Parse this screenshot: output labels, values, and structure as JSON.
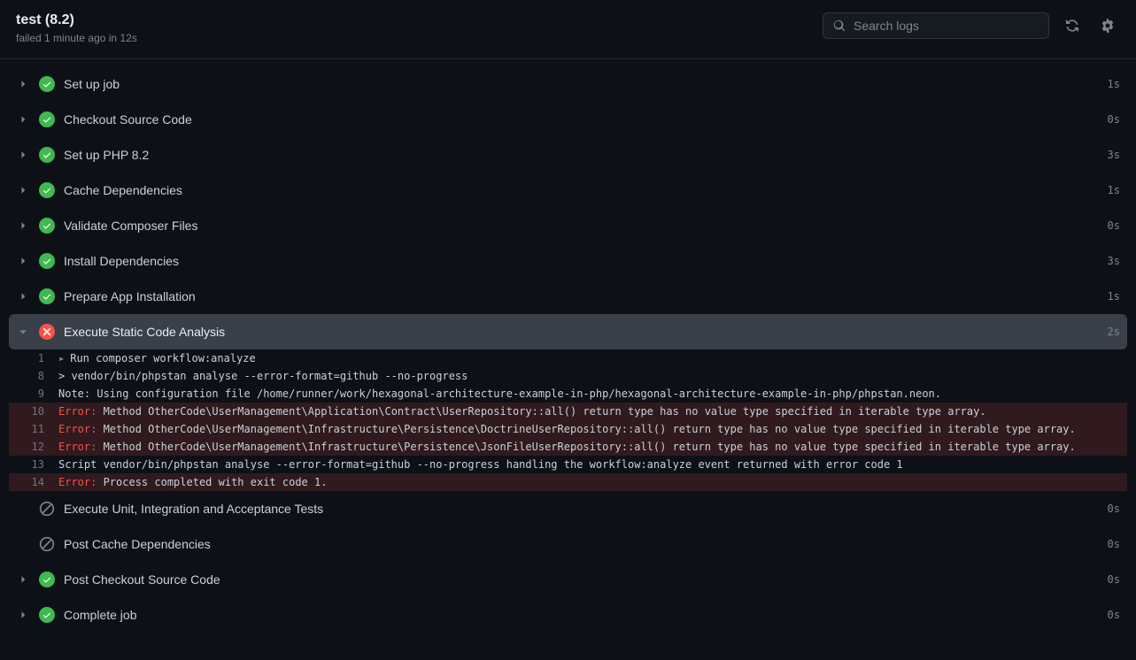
{
  "header": {
    "title": "test (8.2)",
    "status_word": "failed",
    "when": "1 minute ago",
    "duration_join": "in",
    "duration": "12s",
    "search_placeholder": "Search logs"
  },
  "steps": [
    {
      "name": "Set up job",
      "status": "success",
      "duration": "1s",
      "expandable": true,
      "expanded": false
    },
    {
      "name": "Checkout Source Code",
      "status": "success",
      "duration": "0s",
      "expandable": true,
      "expanded": false
    },
    {
      "name": "Set up PHP 8.2",
      "status": "success",
      "duration": "3s",
      "expandable": true,
      "expanded": false
    },
    {
      "name": "Cache Dependencies",
      "status": "success",
      "duration": "1s",
      "expandable": true,
      "expanded": false
    },
    {
      "name": "Validate Composer Files",
      "status": "success",
      "duration": "0s",
      "expandable": true,
      "expanded": false
    },
    {
      "name": "Install Dependencies",
      "status": "success",
      "duration": "3s",
      "expandable": true,
      "expanded": false
    },
    {
      "name": "Prepare App Installation",
      "status": "success",
      "duration": "1s",
      "expandable": true,
      "expanded": false
    },
    {
      "name": "Execute Static Code Analysis",
      "status": "fail",
      "duration": "2s",
      "expandable": true,
      "expanded": true
    },
    {
      "name": "Execute Unit, Integration and Acceptance Tests",
      "status": "skipped",
      "duration": "0s",
      "expandable": false,
      "expanded": false
    },
    {
      "name": "Post Cache Dependencies",
      "status": "skipped",
      "duration": "0s",
      "expandable": false,
      "expanded": false
    },
    {
      "name": "Post Checkout Source Code",
      "status": "success",
      "duration": "0s",
      "expandable": true,
      "expanded": false
    },
    {
      "name": "Complete job",
      "status": "success",
      "duration": "0s",
      "expandable": true,
      "expanded": false
    }
  ],
  "log": {
    "lines": [
      {
        "n": "1",
        "kind": "group",
        "prefix": "▸",
        "text": "Run composer workflow:analyze"
      },
      {
        "n": "8",
        "kind": "plain",
        "text": "> vendor/bin/phpstan analyse --error-format=github --no-progress"
      },
      {
        "n": "9",
        "kind": "note",
        "text": "Note: Using configuration file /home/runner/work/hexagonal-architecture-example-in-php/hexagonal-architecture-example-in-php/phpstan.neon."
      },
      {
        "n": "10",
        "kind": "error",
        "label": "Error:",
        "text": " Method OtherCode\\UserManagement\\Application\\Contract\\UserRepository::all() return type has no value type specified in iterable type array."
      },
      {
        "n": "11",
        "kind": "error",
        "label": "Error:",
        "text": " Method OtherCode\\UserManagement\\Infrastructure\\Persistence\\DoctrineUserRepository::all() return type has no value type specified in iterable type array."
      },
      {
        "n": "12",
        "kind": "error",
        "label": "Error:",
        "text": " Method OtherCode\\UserManagement\\Infrastructure\\Persistence\\JsonFileUserRepository::all() return type has no value type specified in iterable type array."
      },
      {
        "n": "13",
        "kind": "script",
        "text": "Script vendor/bin/phpstan analyse --error-format=github --no-progress handling the workflow:analyze event returned with error code 1"
      },
      {
        "n": "14",
        "kind": "error",
        "label": "Error:",
        "text": " Process completed with exit code 1."
      }
    ]
  }
}
